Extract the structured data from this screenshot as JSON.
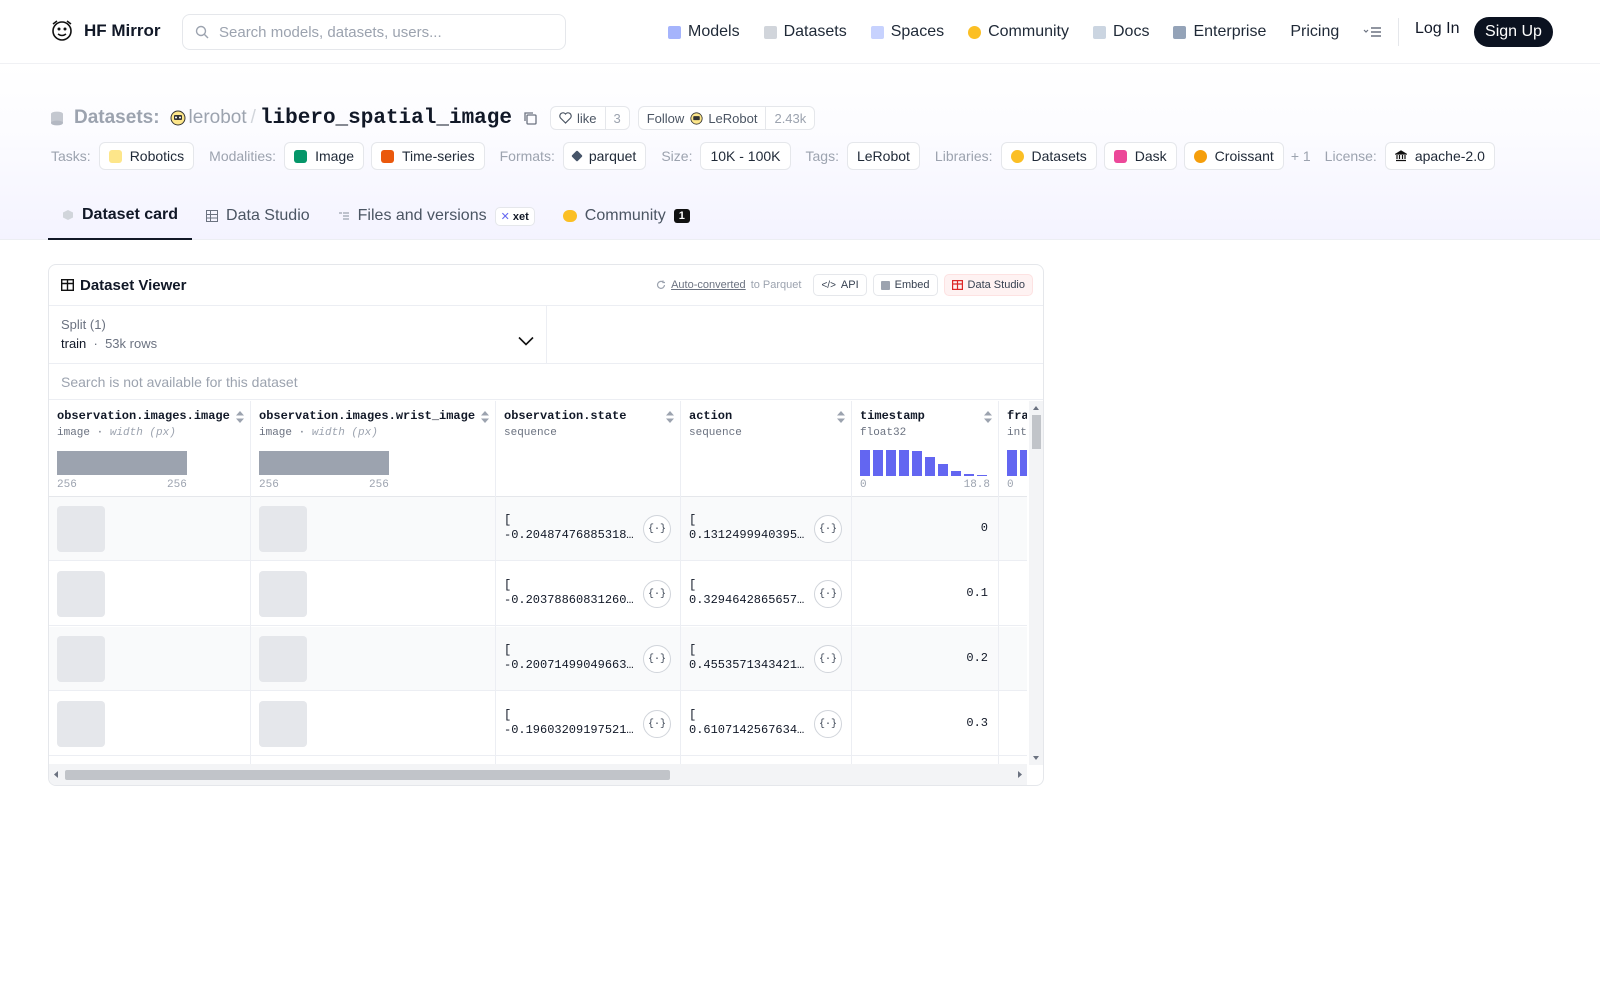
{
  "header": {
    "brand": "HF Mirror",
    "search_placeholder": "Search models, datasets, users...",
    "nav": [
      {
        "label": "Models",
        "icon": "models-icon",
        "color": "#a5b4fc"
      },
      {
        "label": "Datasets",
        "icon": "datasets-icon",
        "color": "#d1d5db"
      },
      {
        "label": "Spaces",
        "icon": "spaces-icon",
        "color": "#c7d2fe"
      },
      {
        "label": "Community",
        "icon": "community-icon",
        "color": "#fbbf24"
      },
      {
        "label": "Docs",
        "icon": "docs-icon",
        "color": "#cbd5e1"
      },
      {
        "label": "Enterprise",
        "icon": "enterprise-icon",
        "color": "#94a3b8"
      },
      {
        "label": "Pricing"
      }
    ],
    "login": "Log In",
    "signup": "Sign Up"
  },
  "dataset": {
    "label": "Datasets:",
    "owner": "lerobot",
    "name": "libero_spatial_image",
    "like_label": "like",
    "like_count": "3",
    "follow_label": "Follow",
    "follow_org": "LeRobot",
    "follow_count": "2.43k"
  },
  "tags": {
    "tasks_label": "Tasks:",
    "tasks": [
      "Robotics"
    ],
    "modalities_label": "Modalities:",
    "modalities": [
      "Image",
      "Time-series"
    ],
    "formats_label": "Formats:",
    "formats": [
      "parquet"
    ],
    "size_label": "Size:",
    "size": "10K - 100K",
    "tags_label": "Tags:",
    "tags": [
      "LeRobot"
    ],
    "libraries_label": "Libraries:",
    "libraries": [
      "Datasets",
      "Dask",
      "Croissant"
    ],
    "libraries_more": "+ 1",
    "license_label": "License:",
    "license": "apache-2.0"
  },
  "tabs": [
    {
      "label": "Dataset card",
      "active": true
    },
    {
      "label": "Data Studio"
    },
    {
      "label": "Files and versions",
      "badge": "xet"
    },
    {
      "label": "Community",
      "count": "1"
    }
  ],
  "viewer": {
    "title": "Dataset Viewer",
    "auto_converted": "Auto-converted",
    "to_parquet": "to Parquet",
    "api": "API",
    "embed": "Embed",
    "data_studio": "Data Studio",
    "split_label": "Split (1)",
    "split_value": "train",
    "split_rows": "53k rows",
    "search_na": "Search is not available for this dataset",
    "columns": [
      {
        "name": "observation.images.image",
        "type": "image",
        "sub": "width (px)",
        "min": "256",
        "max": "256"
      },
      {
        "name": "observation.images.wrist_image",
        "type": "image",
        "sub": "width (px)",
        "min": "256",
        "max": "256"
      },
      {
        "name": "observation.state",
        "type": "sequence"
      },
      {
        "name": "action",
        "type": "sequence"
      },
      {
        "name": "timestamp",
        "type": "float32",
        "min": "0",
        "max": "18.8"
      },
      {
        "name": "fra",
        "type": "int",
        "min": "0"
      }
    ],
    "rows": [
      {
        "state": "-0.20487476885318…",
        "action": "0.1312499940395…",
        "timestamp": "0"
      },
      {
        "state": "-0.20378860831260…",
        "action": "0.3294642865657…",
        "timestamp": "0.1"
      },
      {
        "state": "-0.20071499049663…",
        "action": "0.4553571343421…",
        "timestamp": "0.2"
      },
      {
        "state": "-0.19603209197521…",
        "action": "0.6107142567634…",
        "timestamp": "0.3"
      }
    ],
    "bracket": "[",
    "json_icon": "{·}"
  }
}
